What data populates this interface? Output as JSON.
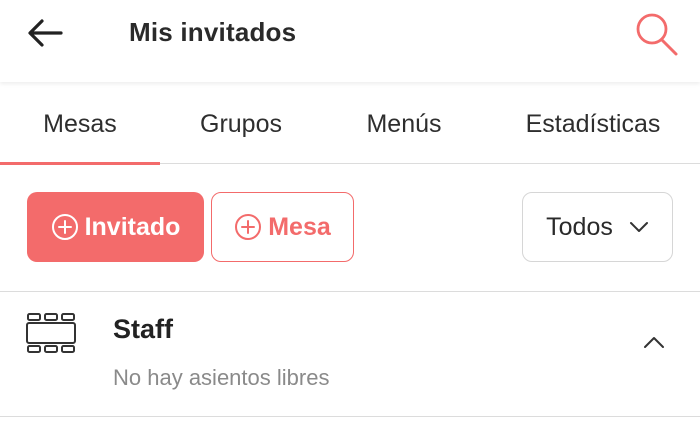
{
  "header": {
    "title": "Mis invitados",
    "back_icon": "arrow-left-icon",
    "search_icon": "search-icon"
  },
  "tabs": [
    {
      "label": "Mesas",
      "active": true
    },
    {
      "label": "Grupos",
      "active": false
    },
    {
      "label": "Menús",
      "active": false
    },
    {
      "label": "Estadísticas",
      "active": false
    }
  ],
  "actions": {
    "add_guest_label": "Invitado",
    "add_table_label": "Mesa",
    "filter_value": "Todos"
  },
  "tables": [
    {
      "name": "Staff",
      "status": "No hay asientos libres",
      "expanded": true
    }
  ],
  "colors": {
    "accent": "#f36b6b",
    "text": "#222222",
    "muted": "#8a8a8a",
    "divider": "#dcdcdc"
  }
}
